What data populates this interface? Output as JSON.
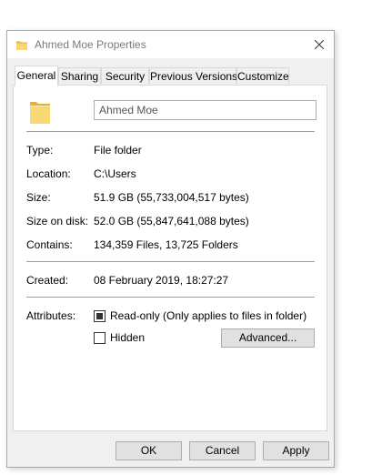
{
  "window": {
    "title": "Ahmed Moe Properties"
  },
  "tabs": [
    {
      "label": "General",
      "active": true
    },
    {
      "label": "Sharing",
      "active": false
    },
    {
      "label": "Security",
      "active": false
    },
    {
      "label": "Previous Versions",
      "active": false
    },
    {
      "label": "Customize",
      "active": false
    }
  ],
  "general": {
    "name_value": "Ahmed Moe",
    "rows": {
      "type": {
        "label": "Type:",
        "value": "File folder"
      },
      "location": {
        "label": "Location:",
        "value": "C:\\Users"
      },
      "size": {
        "label": "Size:",
        "value": "51.9 GB (55,733,004,517 bytes)"
      },
      "size_on_disk": {
        "label": "Size on disk:",
        "value": "52.0 GB (55,847,641,088 bytes)"
      },
      "contains": {
        "label": "Contains:",
        "value": "134,359 Files, 13,725 Folders"
      },
      "created": {
        "label": "Created:",
        "value": "08 February 2019, 18:27:27"
      }
    },
    "attributes": {
      "label": "Attributes:",
      "readonly_label": "Read-only (Only applies to files in folder)",
      "readonly_state": "indeterminate",
      "hidden_label": "Hidden",
      "hidden_state": "unchecked",
      "advanced_label": "Advanced..."
    }
  },
  "footer": {
    "ok_label": "OK",
    "cancel_label": "Cancel",
    "apply_label": "Apply"
  },
  "colors": {
    "folder_yellow": "#f8d775",
    "folder_dark": "#e3b23c",
    "dialog_bg": "#f0f0f0",
    "button_bg": "#e1e1e1"
  },
  "icons": {
    "title": "folder-icon",
    "close": "close-icon",
    "large": "folder-icon"
  }
}
